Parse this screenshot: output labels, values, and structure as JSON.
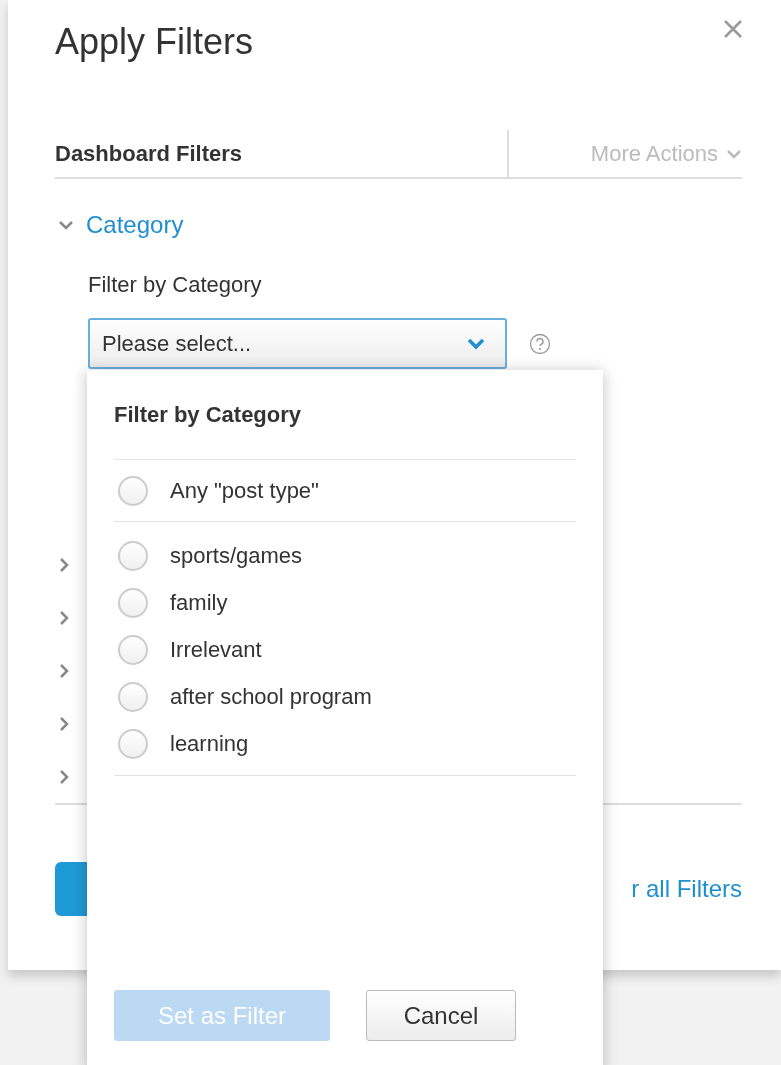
{
  "dialog": {
    "title": "Apply Filters"
  },
  "header": {
    "title": "Dashboard Filters",
    "more_actions": "More Actions"
  },
  "filter_groups": [
    {
      "label": "Category",
      "expanded": true,
      "field_label": "Filter by Category",
      "select": {
        "placeholder": "Please select..."
      }
    },
    {
      "expanded": false
    },
    {
      "expanded": false
    },
    {
      "expanded": false
    },
    {
      "expanded": false
    },
    {
      "expanded": false
    }
  ],
  "footer": {
    "clear_link": "r all Filters"
  },
  "popup": {
    "title": "Filter by Category",
    "options": [
      {
        "label": "Any \"post type\"",
        "kind": "any",
        "selected": false
      },
      {
        "label": "sports/games",
        "kind": "value",
        "selected": false
      },
      {
        "label": "family",
        "kind": "value",
        "selected": false
      },
      {
        "label": "Irrelevant",
        "kind": "value",
        "selected": false
      },
      {
        "label": "after school program",
        "kind": "value",
        "selected": false
      },
      {
        "label": "learning",
        "kind": "value",
        "selected": false
      }
    ],
    "buttons": [
      {
        "label": "Set as Filter",
        "kind": "primary",
        "disabled": true
      },
      {
        "label": "Cancel",
        "kind": "secondary",
        "disabled": false
      }
    ]
  }
}
